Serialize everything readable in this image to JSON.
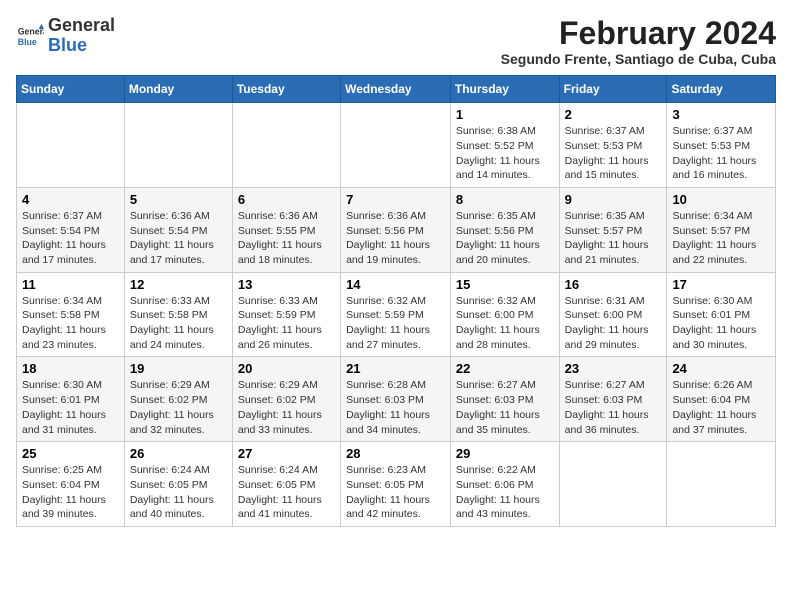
{
  "logo": {
    "text_general": "General",
    "text_blue": "Blue"
  },
  "header": {
    "title": "February 2024",
    "subtitle": "Segundo Frente, Santiago de Cuba, Cuba"
  },
  "columns": [
    "Sunday",
    "Monday",
    "Tuesday",
    "Wednesday",
    "Thursday",
    "Friday",
    "Saturday"
  ],
  "weeks": [
    [
      {
        "day": "",
        "sunrise": "",
        "sunset": "",
        "daylight": ""
      },
      {
        "day": "",
        "sunrise": "",
        "sunset": "",
        "daylight": ""
      },
      {
        "day": "",
        "sunrise": "",
        "sunset": "",
        "daylight": ""
      },
      {
        "day": "",
        "sunrise": "",
        "sunset": "",
        "daylight": ""
      },
      {
        "day": "1",
        "sunrise": "Sunrise: 6:38 AM",
        "sunset": "Sunset: 5:52 PM",
        "daylight": "Daylight: 11 hours and 14 minutes."
      },
      {
        "day": "2",
        "sunrise": "Sunrise: 6:37 AM",
        "sunset": "Sunset: 5:53 PM",
        "daylight": "Daylight: 11 hours and 15 minutes."
      },
      {
        "day": "3",
        "sunrise": "Sunrise: 6:37 AM",
        "sunset": "Sunset: 5:53 PM",
        "daylight": "Daylight: 11 hours and 16 minutes."
      }
    ],
    [
      {
        "day": "4",
        "sunrise": "Sunrise: 6:37 AM",
        "sunset": "Sunset: 5:54 PM",
        "daylight": "Daylight: 11 hours and 17 minutes."
      },
      {
        "day": "5",
        "sunrise": "Sunrise: 6:36 AM",
        "sunset": "Sunset: 5:54 PM",
        "daylight": "Daylight: 11 hours and 17 minutes."
      },
      {
        "day": "6",
        "sunrise": "Sunrise: 6:36 AM",
        "sunset": "Sunset: 5:55 PM",
        "daylight": "Daylight: 11 hours and 18 minutes."
      },
      {
        "day": "7",
        "sunrise": "Sunrise: 6:36 AM",
        "sunset": "Sunset: 5:56 PM",
        "daylight": "Daylight: 11 hours and 19 minutes."
      },
      {
        "day": "8",
        "sunrise": "Sunrise: 6:35 AM",
        "sunset": "Sunset: 5:56 PM",
        "daylight": "Daylight: 11 hours and 20 minutes."
      },
      {
        "day": "9",
        "sunrise": "Sunrise: 6:35 AM",
        "sunset": "Sunset: 5:57 PM",
        "daylight": "Daylight: 11 hours and 21 minutes."
      },
      {
        "day": "10",
        "sunrise": "Sunrise: 6:34 AM",
        "sunset": "Sunset: 5:57 PM",
        "daylight": "Daylight: 11 hours and 22 minutes."
      }
    ],
    [
      {
        "day": "11",
        "sunrise": "Sunrise: 6:34 AM",
        "sunset": "Sunset: 5:58 PM",
        "daylight": "Daylight: 11 hours and 23 minutes."
      },
      {
        "day": "12",
        "sunrise": "Sunrise: 6:33 AM",
        "sunset": "Sunset: 5:58 PM",
        "daylight": "Daylight: 11 hours and 24 minutes."
      },
      {
        "day": "13",
        "sunrise": "Sunrise: 6:33 AM",
        "sunset": "Sunset: 5:59 PM",
        "daylight": "Daylight: 11 hours and 26 minutes."
      },
      {
        "day": "14",
        "sunrise": "Sunrise: 6:32 AM",
        "sunset": "Sunset: 5:59 PM",
        "daylight": "Daylight: 11 hours and 27 minutes."
      },
      {
        "day": "15",
        "sunrise": "Sunrise: 6:32 AM",
        "sunset": "Sunset: 6:00 PM",
        "daylight": "Daylight: 11 hours and 28 minutes."
      },
      {
        "day": "16",
        "sunrise": "Sunrise: 6:31 AM",
        "sunset": "Sunset: 6:00 PM",
        "daylight": "Daylight: 11 hours and 29 minutes."
      },
      {
        "day": "17",
        "sunrise": "Sunrise: 6:30 AM",
        "sunset": "Sunset: 6:01 PM",
        "daylight": "Daylight: 11 hours and 30 minutes."
      }
    ],
    [
      {
        "day": "18",
        "sunrise": "Sunrise: 6:30 AM",
        "sunset": "Sunset: 6:01 PM",
        "daylight": "Daylight: 11 hours and 31 minutes."
      },
      {
        "day": "19",
        "sunrise": "Sunrise: 6:29 AM",
        "sunset": "Sunset: 6:02 PM",
        "daylight": "Daylight: 11 hours and 32 minutes."
      },
      {
        "day": "20",
        "sunrise": "Sunrise: 6:29 AM",
        "sunset": "Sunset: 6:02 PM",
        "daylight": "Daylight: 11 hours and 33 minutes."
      },
      {
        "day": "21",
        "sunrise": "Sunrise: 6:28 AM",
        "sunset": "Sunset: 6:03 PM",
        "daylight": "Daylight: 11 hours and 34 minutes."
      },
      {
        "day": "22",
        "sunrise": "Sunrise: 6:27 AM",
        "sunset": "Sunset: 6:03 PM",
        "daylight": "Daylight: 11 hours and 35 minutes."
      },
      {
        "day": "23",
        "sunrise": "Sunrise: 6:27 AM",
        "sunset": "Sunset: 6:03 PM",
        "daylight": "Daylight: 11 hours and 36 minutes."
      },
      {
        "day": "24",
        "sunrise": "Sunrise: 6:26 AM",
        "sunset": "Sunset: 6:04 PM",
        "daylight": "Daylight: 11 hours and 37 minutes."
      }
    ],
    [
      {
        "day": "25",
        "sunrise": "Sunrise: 6:25 AM",
        "sunset": "Sunset: 6:04 PM",
        "daylight": "Daylight: 11 hours and 39 minutes."
      },
      {
        "day": "26",
        "sunrise": "Sunrise: 6:24 AM",
        "sunset": "Sunset: 6:05 PM",
        "daylight": "Daylight: 11 hours and 40 minutes."
      },
      {
        "day": "27",
        "sunrise": "Sunrise: 6:24 AM",
        "sunset": "Sunset: 6:05 PM",
        "daylight": "Daylight: 11 hours and 41 minutes."
      },
      {
        "day": "28",
        "sunrise": "Sunrise: 6:23 AM",
        "sunset": "Sunset: 6:05 PM",
        "daylight": "Daylight: 11 hours and 42 minutes."
      },
      {
        "day": "29",
        "sunrise": "Sunrise: 6:22 AM",
        "sunset": "Sunset: 6:06 PM",
        "daylight": "Daylight: 11 hours and 43 minutes."
      },
      {
        "day": "",
        "sunrise": "",
        "sunset": "",
        "daylight": ""
      },
      {
        "day": "",
        "sunrise": "",
        "sunset": "",
        "daylight": ""
      }
    ]
  ]
}
